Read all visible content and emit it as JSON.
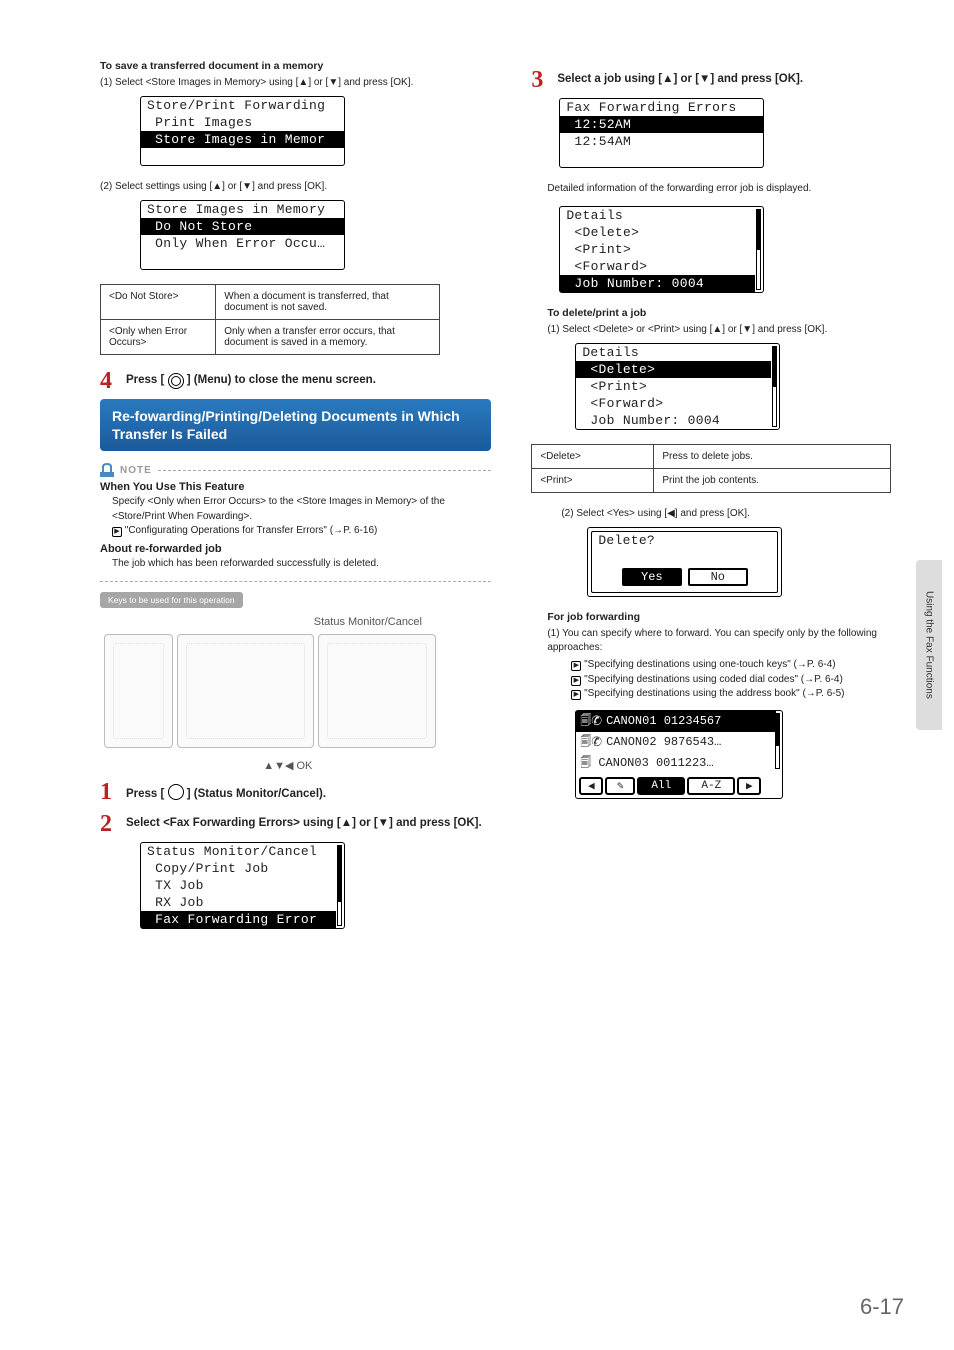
{
  "left": {
    "save_title": "To save a transferred document in a memory",
    "save_step": "(1)  Select <Store Images in Memory> using [▲] or [▼] and press [OK].",
    "lcd1": {
      "title": "Store/Print Forwarding",
      "r1": " Print Images",
      "r2": " Store Images in Memor"
    },
    "sel_settings": "(2)  Select settings using [▲] or [▼] and press [OK].",
    "lcd2": {
      "title": "Store Images in Memory",
      "r1": " Do Not Store",
      "r2": " Only When Error Occu…"
    },
    "opt": {
      "a1": "<Do Not Store>",
      "a2": "When a document is transferred, that document is not saved.",
      "b1": "<Only when Error Occurs>",
      "b2": "Only when a transfer error occurs, that document is saved in a memory."
    },
    "step4": "Press [        ] (Menu) to close the menu screen.",
    "blue": "Re-fowarding/Printing/Deleting Documents in Which Transfer Is Failed",
    "note_label": "NOTE",
    "note1_t": "When You Use This Feature",
    "note1_p": "Specify <Only when Error Occurs> to the <Store Images in Memory> of the <Store/Print When Fowarding>.",
    "note1_ref": "\"Configurating Operations for Transfer Errors\" (→P. 6-16)",
    "note2_t": "About re-forwarded job",
    "note2_p": "The job which has been reforwarded successfully is deleted.",
    "keys_badge": "Keys to be used for this operation",
    "device_top": "Status Monitor/Cancel",
    "device_bottom": "▲▼◀ OK",
    "step1": "Press [       ] (Status Monitor/Cancel).",
    "step2": "Select <Fax Forwarding Errors> using [▲] or [▼] and press [OK].",
    "lcd3": {
      "title": "Status Monitor/Cancel",
      "r1": " Copy/Print Job",
      "r2": " TX Job",
      "r3": " RX Job",
      "r4": " Fax Forwarding Error"
    }
  },
  "right": {
    "step3": "Select a job using [▲] or [▼] and press [OK].",
    "lcd4": {
      "title": "Fax Forwarding Errors",
      "r1": " 12:52AM",
      "r2": " 12:54AM"
    },
    "detail_line": "Detailed information of the forwarding error job is displayed.",
    "lcd5": {
      "title": "Details",
      "r1": " <Delete>",
      "r2": " <Print>",
      "r3": " <Forward>",
      "r4": " Job Number: 0004"
    },
    "del_title": "To delete/print a job",
    "del_step": "(1)  Select <Delete> or <Print> using [▲] or [▼] and press [OK].",
    "lcd6": {
      "title": "Details",
      "r1": " <Delete>",
      "r2": " <Print>",
      "r3": " <Forward>",
      "r4": " Job Number: 0004"
    },
    "tbl": {
      "a1": "<Delete>",
      "a2": "Press to delete jobs.",
      "b1": "<Print>",
      "b2": "Print the job contents."
    },
    "yes_step": "(2)  Select <Yes> using [◀] and press [OK].",
    "lcd7": {
      "title": "Delete?",
      "yes": "Yes",
      "no": "No"
    },
    "fwd_title": "For job forwarding",
    "fwd_step": "(1)  You can specify where to forward. You can specify only by the following approaches:",
    "ref1": "\"Specifying destinations using one-touch keys\" (→P. 6-4)",
    "ref2": "\"Specifying destinations using coded dial codes\" (→P. 6-4)",
    "ref3": "\"Specifying destinations using the address book\" (→P. 6-5)",
    "dest": {
      "r1": "CANON01 01234567",
      "r2": "CANON02 9876543…",
      "r3": "CANON03 0011223…",
      "b3": "All",
      "b4": "A-Z"
    }
  },
  "sidetab": "Using the Fax Functions",
  "pagenum": "6-17"
}
